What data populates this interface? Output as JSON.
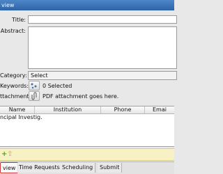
{
  "window": {
    "title": "view"
  },
  "form": {
    "title_label": "Title:",
    "title_value": "",
    "abstract_label": "Abstract:",
    "abstract_value": "",
    "category_label": "Category:",
    "category_value": "Select",
    "keywords_label": "Keywords:",
    "keywords_status": "0 Selected",
    "attachment_label": "ttachment:",
    "attachment_text": "PDF attachment goes here."
  },
  "table": {
    "columns": [
      "Name",
      "Institution",
      "Phone",
      "Emai"
    ],
    "rows": [
      [
        "ncipal Investig...",
        "",
        "",
        ""
      ]
    ]
  },
  "toolbar": {
    "add_icon": "plus-icon",
    "up_icon": "arrow-up-icon"
  },
  "tabs": [
    {
      "label": "view",
      "active": true
    },
    {
      "label": "Time Requests",
      "active": false
    },
    {
      "label": "Scheduling",
      "active": false
    },
    {
      "label": "Submit",
      "active": false
    }
  ],
  "colors": {
    "titlebar": "#3a72b8",
    "toolbar_bg": "#f7f1c4",
    "active_tab_border": "#d23a3a"
  }
}
